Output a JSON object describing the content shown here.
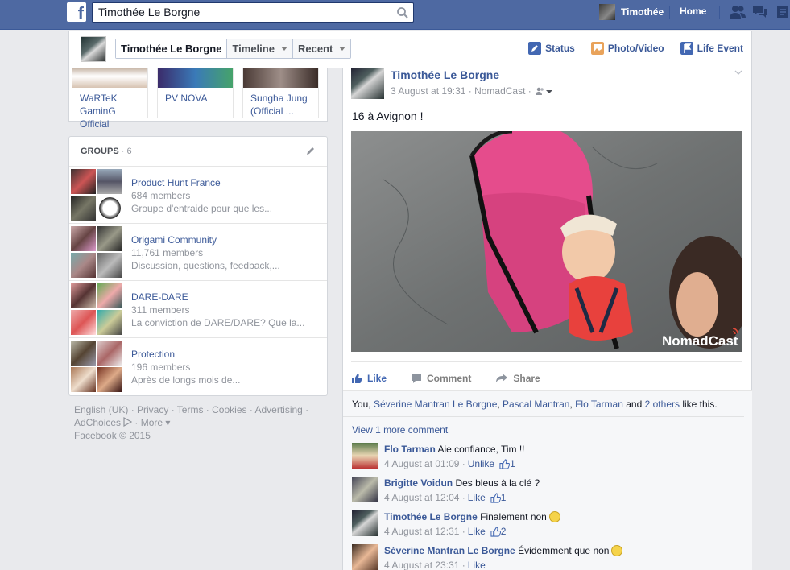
{
  "topbar": {
    "search_value": "Timothée Le Borgne",
    "user_name": "Timothée",
    "home_label": "Home",
    "brand_color": "#4e69a2"
  },
  "cover": {
    "crumbs": [
      "Timothée Le Borgne",
      "Timeline",
      "Recent"
    ],
    "actions": [
      "Status",
      "Photo/Video",
      "Life Event"
    ]
  },
  "likes": [
    {
      "label_1": "WaRTeK",
      "label_2": "GaminG Official"
    },
    {
      "label_1": "PV NOVA",
      "label_2": ""
    },
    {
      "label_1": "Sungha Jung",
      "label_2": "(Official ..."
    }
  ],
  "groups": {
    "title": "GROUPS",
    "count": "· 6",
    "items": [
      {
        "name": "Product Hunt France",
        "members": "684 members",
        "desc": "Groupe d'entraide pour que les..."
      },
      {
        "name": "Origami Community",
        "members": "11,761 members",
        "desc": "Discussion, questions, feedback,..."
      },
      {
        "name": "DARE-DARE",
        "members": "311 members",
        "desc": "La conviction de DARE/DARE? Que la..."
      },
      {
        "name": "Protection",
        "members": "196 members",
        "desc": "Après de longs mois de..."
      }
    ]
  },
  "footer": {
    "line1": "English (UK) · Privacy · Terms · Cookies · Advertising ·",
    "adchoices": "AdChoices",
    "more": "· More ▾",
    "line3": "Facebook © 2015"
  },
  "post": {
    "author": "Timothée Le Borgne",
    "timestamp": "3 August at 19:31 · NomadCast ·",
    "text": "16 à Avignon !",
    "watermark": "NomadCast",
    "actions": {
      "like": "Like",
      "comment": "Comment",
      "share": "Share"
    },
    "likes_prefix": "You,",
    "likers": [
      "Séverine Mantran Le Borgne",
      "Pascal Mantran",
      "Flo Tarman"
    ],
    "likes_and": "and",
    "likes_others": "2 others",
    "likes_suffix": "like this.",
    "view_more": "View 1 more comment",
    "comments": [
      {
        "name": "Flo Tarman",
        "text": "Aie confiance, Tim !!",
        "time": "4 August at 01:09 ·",
        "action": "Unlike",
        "likes": "1"
      },
      {
        "name": "Brigitte Voidun",
        "text": "Des bleus à la clé ?",
        "time": "4 August at 12:04 ·",
        "action": "Like",
        "likes": "1"
      },
      {
        "name": "Timothée Le Borgne",
        "text": "Finalement non",
        "time": "4 August at 12:31 ·",
        "action": "Like",
        "likes": "2"
      },
      {
        "name": "Séverine Mantran Le Borgne",
        "text": "Évidemment que non",
        "time": "4 August at 23:31 ·",
        "action": "Like",
        "likes": ""
      }
    ]
  }
}
